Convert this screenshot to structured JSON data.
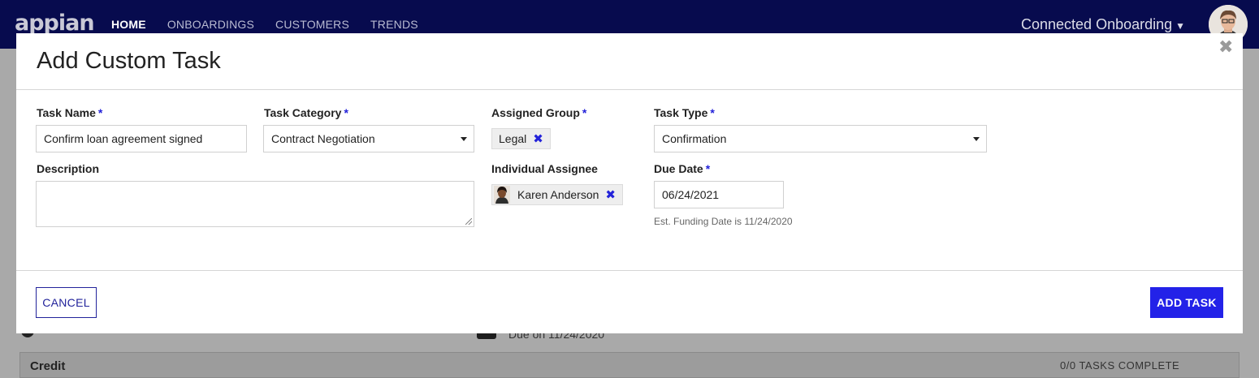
{
  "nav": {
    "logo": "appian",
    "items": [
      {
        "label": "HOME"
      },
      {
        "label": "ONBOARDINGS"
      },
      {
        "label": "CUSTOMERS"
      },
      {
        "label": "TRENDS"
      }
    ],
    "app_name": "Connected Onboarding"
  },
  "background": {
    "due_text": "Due on 11/24/2020",
    "card_title": "Credit",
    "card_status": "0/0 TASKS COMPLETE"
  },
  "modal": {
    "title": "Add Custom Task",
    "close_glyph": "✖",
    "required_marker": "*",
    "task_name": {
      "label": "Task Name",
      "value": "Confirm loan agreement signed"
    },
    "task_category": {
      "label": "Task Category",
      "value": "Contract Negotiation"
    },
    "assigned_group": {
      "label": "Assigned Group",
      "value": "Legal"
    },
    "task_type": {
      "label": "Task Type",
      "value": "Confirmation"
    },
    "description": {
      "label": "Description",
      "value": ""
    },
    "individual_assignee": {
      "label": "Individual Assignee",
      "value": "Karen Anderson"
    },
    "due_date": {
      "label": "Due Date",
      "value": "06/24/2021",
      "helper": "Est. Funding Date is 11/24/2020"
    },
    "remove_glyph": "✖",
    "cancel_label": "CANCEL",
    "submit_label": "ADD TASK"
  },
  "colors": {
    "nav_bg": "#070b4e",
    "accent": "#2322e8",
    "overlay": "#a9a9a9"
  }
}
